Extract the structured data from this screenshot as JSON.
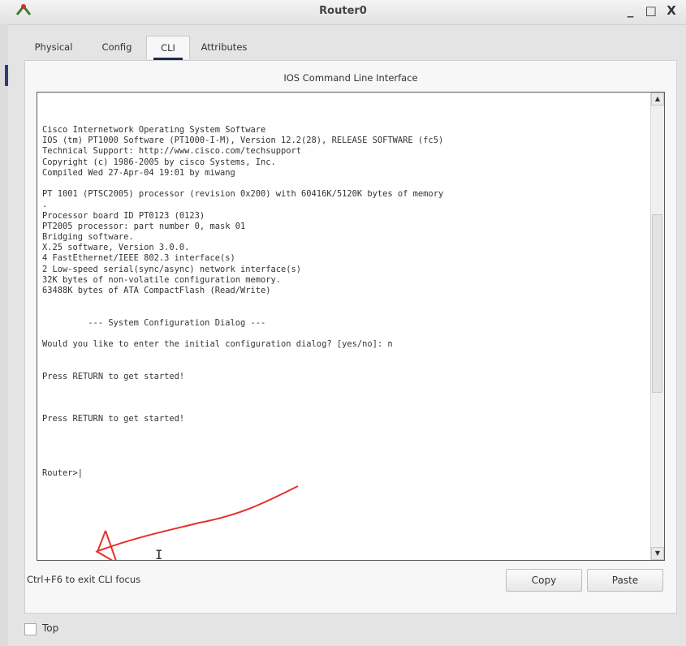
{
  "window": {
    "title": "Router0",
    "controls": [
      "_",
      "□",
      "X"
    ]
  },
  "tabs": [
    {
      "label": "Physical",
      "active": false
    },
    {
      "label": "Config",
      "active": false
    },
    {
      "label": "CLI",
      "active": true
    },
    {
      "label": "Attributes",
      "active": false
    }
  ],
  "cli": {
    "title": "IOS Command Line Interface",
    "output_lines": [
      "Cisco Internetwork Operating System Software",
      "IOS (tm) PT1000 Software (PT1000-I-M), Version 12.2(28), RELEASE SOFTWARE (fc5)",
      "Technical Support: http://www.cisco.com/techsupport",
      "Copyright (c) 1986-2005 by cisco Systems, Inc.",
      "Compiled Wed 27-Apr-04 19:01 by miwang",
      "",
      "PT 1001 (PTSC2005) processor (revision 0x200) with 60416K/5120K bytes of memory",
      ".",
      "Processor board ID PT0123 (0123)",
      "PT2005 processor: part number 0, mask 01",
      "Bridging software.",
      "X.25 software, Version 3.0.0.",
      "4 FastEthernet/IEEE 802.3 interface(s)",
      "2 Low-speed serial(sync/async) network interface(s)",
      "32K bytes of non-volatile configuration memory.",
      "63488K bytes of ATA CompactFlash (Read/Write)",
      "",
      "",
      "         --- System Configuration Dialog ---",
      "",
      "Would you like to enter the initial configuration dialog? [yes/no]: n",
      "",
      "",
      "Press RETURN to get started!",
      "",
      "",
      "",
      "Press RETURN to get started!",
      "",
      "",
      "",
      "",
      "Router>|"
    ],
    "scroll_position": 0.45
  },
  "footer": {
    "hint": "Ctrl+F6 to exit CLI focus",
    "copy_label": "Copy",
    "paste_label": "Paste"
  },
  "bottom": {
    "top_label": "Top",
    "top_checked": false
  },
  "colors": {
    "annotation_arrow": "#e8302a",
    "tab_underline": "#1e2b4f"
  }
}
